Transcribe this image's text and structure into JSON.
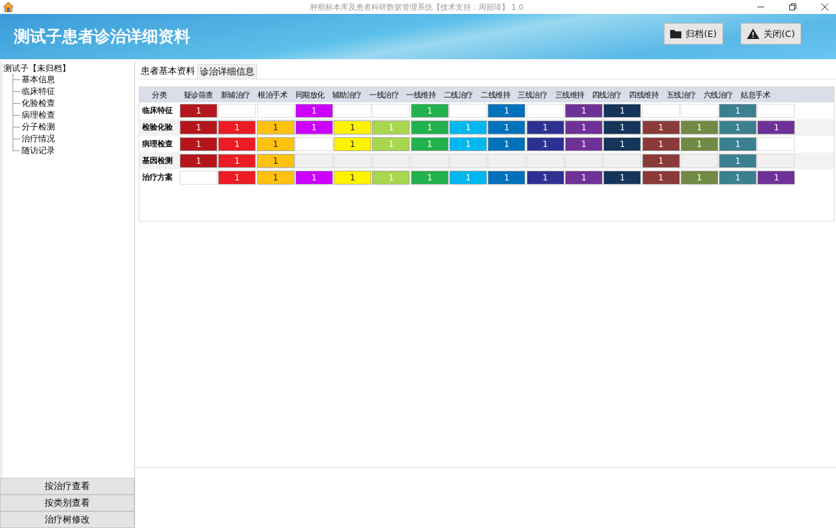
{
  "window": {
    "title": "肿瘤标本库及患者科研数据管理系统【技术支持：周韶璋】 1.0"
  },
  "header": {
    "title": "测试子患者诊治详细资料",
    "buttons": [
      {
        "label": "归档(E)",
        "kind": "folder"
      },
      {
        "label": "关闭(C)",
        "kind": "warning"
      }
    ]
  },
  "tree": {
    "label": "测试子【未归档】",
    "children": [
      {
        "label": "基本信息"
      },
      {
        "label": "临床特征"
      },
      {
        "label": "化验检查"
      },
      {
        "label": "病理检查"
      },
      {
        "label": "分子检测"
      },
      {
        "label": "治疗情况"
      },
      {
        "label": "随访记录"
      }
    ]
  },
  "side_buttons": [
    "按治疗查看",
    "按类别查看",
    "治疗树修改"
  ],
  "tabs": [
    {
      "label": "患者基本资料",
      "selected": false
    },
    {
      "label": "诊治详细信息",
      "selected": true
    }
  ],
  "table": {
    "corner": "分类",
    "columns": [
      {
        "label": "疑诊筛查",
        "color": "#b5161b"
      },
      {
        "label": "新辅治疗",
        "color": "#ed1c24"
      },
      {
        "label": "根治手术",
        "color": "#ffc20e"
      },
      {
        "label": "同期放化",
        "color": "#cc00ff"
      },
      {
        "label": "辅助治疗",
        "color": "#fff200"
      },
      {
        "label": "一线治疗",
        "color": "#a8d64e"
      },
      {
        "label": "一线维持",
        "color": "#22b14c"
      },
      {
        "label": "二线治疗",
        "color": "#00b7ef"
      },
      {
        "label": "二线维持",
        "color": "#0072bc"
      },
      {
        "label": "三线治疗",
        "color": "#2e3192"
      },
      {
        "label": "三线维持",
        "color": "#6f3198"
      },
      {
        "label": "四线治疗",
        "color": "#16355b"
      },
      {
        "label": "四线维持",
        "color": "#8b3a3a"
      },
      {
        "label": "五线治疗",
        "color": "#718a43"
      },
      {
        "label": "六线治疗",
        "color": "#3a8090"
      },
      {
        "label": "姑息手术",
        "color": "#6f3198"
      }
    ],
    "rows": [
      {
        "label": "临床特征",
        "shaded": false,
        "cells": [
          "1",
          null,
          null,
          "1",
          null,
          null,
          "1",
          null,
          "1",
          null,
          "1",
          "1",
          null,
          null,
          "1",
          null
        ]
      },
      {
        "label": "检验化验",
        "shaded": true,
        "cells": [
          "1",
          "1",
          "1",
          "1",
          "1",
          "1",
          "1",
          "1",
          "1",
          "1",
          "1",
          "1",
          "1",
          "1",
          "1",
          "1"
        ]
      },
      {
        "label": "病理检查",
        "shaded": false,
        "cells": [
          "1",
          "1",
          "1",
          null,
          "1",
          "1",
          "1",
          "1",
          "1",
          "1",
          "1",
          "1",
          "1",
          "1",
          "1",
          null
        ]
      },
      {
        "label": "基因检测",
        "shaded": true,
        "cells": [
          "1",
          "1",
          "1",
          null,
          null,
          null,
          null,
          null,
          null,
          null,
          null,
          null,
          "1",
          null,
          "1",
          null
        ]
      },
      {
        "label": "治疗方案",
        "shaded": false,
        "cells": [
          null,
          "1",
          "1",
          "1",
          "1",
          "1",
          "1",
          "1",
          "1",
          "1",
          "1",
          "1",
          "1",
          "1",
          "1",
          "1"
        ]
      }
    ]
  }
}
